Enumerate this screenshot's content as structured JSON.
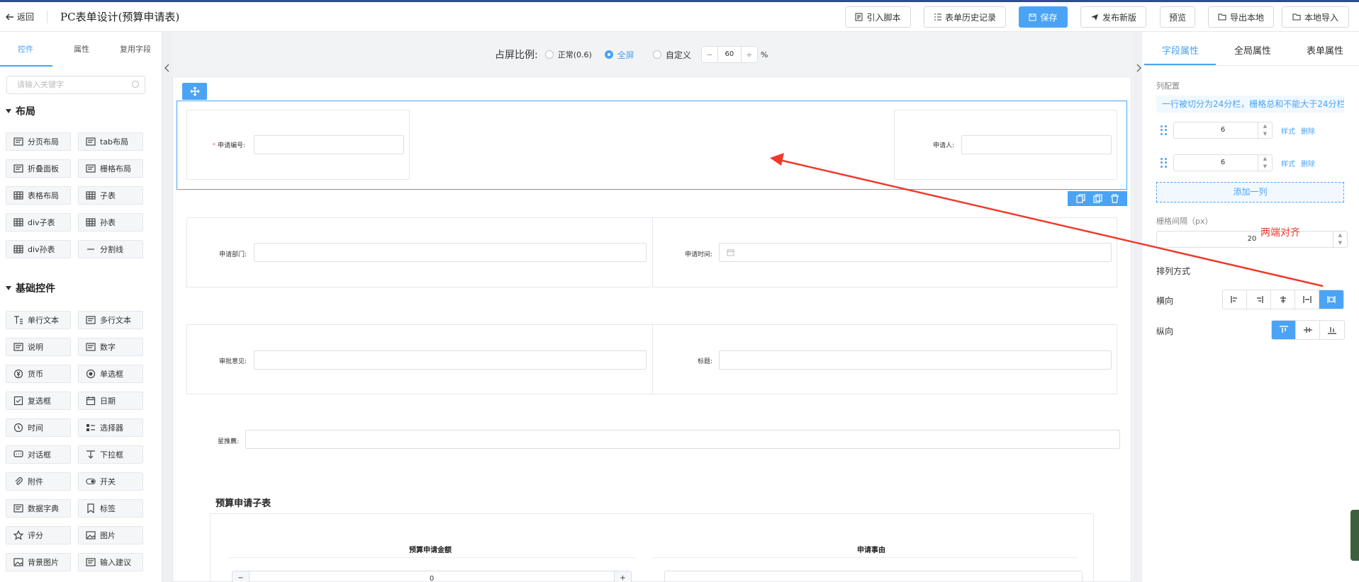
{
  "header": {
    "back_label": "返回",
    "title": "PC表单设计(预算申请表)",
    "buttons": {
      "import_script": "引入脚本",
      "history": "表单历史记录",
      "save": "保存",
      "publish": "发布新版",
      "preview": "预览",
      "export": "导出本地",
      "local_import": "本地导入"
    }
  },
  "left": {
    "tabs": {
      "controls": "控件",
      "props": "属性",
      "reuse": "复用字段"
    },
    "search_placeholder": "请输入关键字",
    "section_layout": "布局",
    "layout_items": [
      "分页布局",
      "tab布局",
      "折叠面板",
      "栅格布局",
      "表格布局",
      "子表",
      "div子表",
      "孙表",
      "div孙表",
      "分割线"
    ],
    "section_basic": "基础控件",
    "basic_items": [
      "单行文本",
      "多行文本",
      "说明",
      "数字",
      "货币",
      "单选框",
      "复选框",
      "日期",
      "时间",
      "选择器",
      "对话框",
      "下拉框",
      "附件",
      "开关",
      "数据字典",
      "标签",
      "评分",
      "图片",
      "背景图片",
      "输入建议"
    ]
  },
  "canvas": {
    "ratio_label": "占屏比例:",
    "ratio_normal": "正常(0.6)",
    "ratio_full": "全屏",
    "ratio_custom": "自定义",
    "ratio_minus": "−",
    "ratio_plus": "+",
    "ratio_value": "60",
    "ratio_unit": "%",
    "fields": {
      "apply_no": "申请编号:",
      "apply_no_req": "*",
      "applicant": "申请人:",
      "department": "申请部门:",
      "apply_time": "申请时间:",
      "approval": "审批意见:",
      "subject": "标题:",
      "summary": "星推薦:"
    },
    "subtable_title": "预算申请子表",
    "subtable_cols": [
      "预算申请金额",
      "申请事由"
    ],
    "subtable_first_value": "0",
    "subtable_minus": "−",
    "subtable_plus": "+"
  },
  "right": {
    "tabs": {
      "field": "字段属性",
      "global": "全局属性",
      "form": "表单属性"
    },
    "col_config": "列配置",
    "hint": "一行被切分为24分栏，栅格总和不能大于24分栏",
    "columns": [
      {
        "value": "6",
        "style": "样式",
        "delete": "删除"
      },
      {
        "value": "6",
        "style": "样式",
        "delete": "删除"
      }
    ],
    "add_col": "添加一列",
    "gutter_label": "栅格间隔（px）",
    "gutter_value": "20",
    "arrange_label": "排列方式",
    "horizontal_label": "横向",
    "vertical_label": "纵向",
    "horizontal_selected_index": 4,
    "vertical_selected_index": 0
  },
  "annotation": {
    "text": "两端对齐",
    "color": "#f0392b"
  },
  "colors": {
    "accent": "#4aa3f5",
    "annotation": "#f0392b"
  }
}
